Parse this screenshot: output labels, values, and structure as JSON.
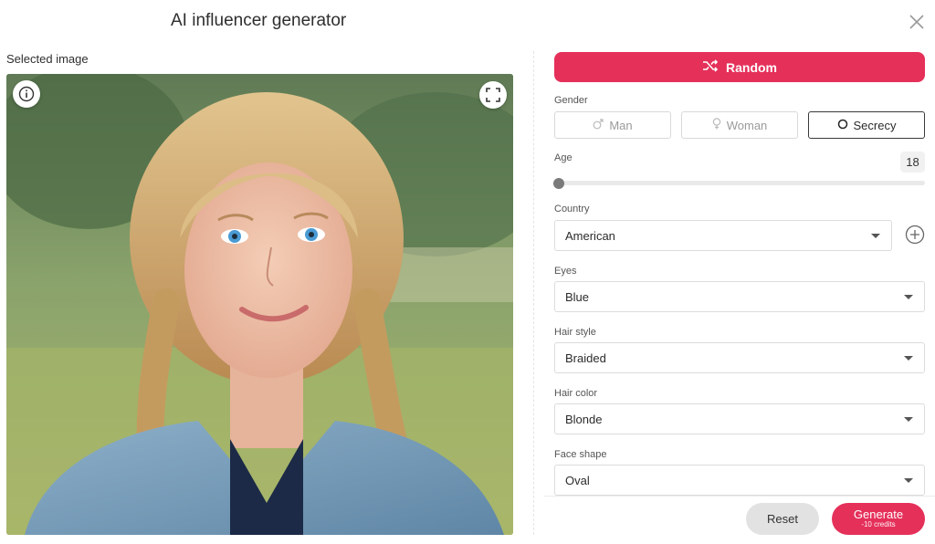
{
  "header": {
    "title": "AI influencer generator"
  },
  "left": {
    "selected_label": "Selected image",
    "image_alt": "Generated portrait of young woman with blonde braided hair"
  },
  "form": {
    "random_label": "Random",
    "gender": {
      "label": "Gender",
      "options": [
        "Man",
        "Woman",
        "Secrecy"
      ],
      "selected": "Secrecy"
    },
    "age": {
      "label": "Age",
      "value": "18"
    },
    "country": {
      "label": "Country",
      "value": "American"
    },
    "eyes": {
      "label": "Eyes",
      "value": "Blue"
    },
    "hair_style": {
      "label": "Hair style",
      "value": "Braided"
    },
    "hair_color": {
      "label": "Hair color",
      "value": "Blonde"
    },
    "face_shape": {
      "label": "Face shape",
      "value": "Oval"
    }
  },
  "footer": {
    "reset_label": "Reset",
    "generate_label": "Generate",
    "generate_cost": "-10 credits"
  },
  "colors": {
    "accent": "#e5305a",
    "reset_bg": "#e2e2e2"
  }
}
